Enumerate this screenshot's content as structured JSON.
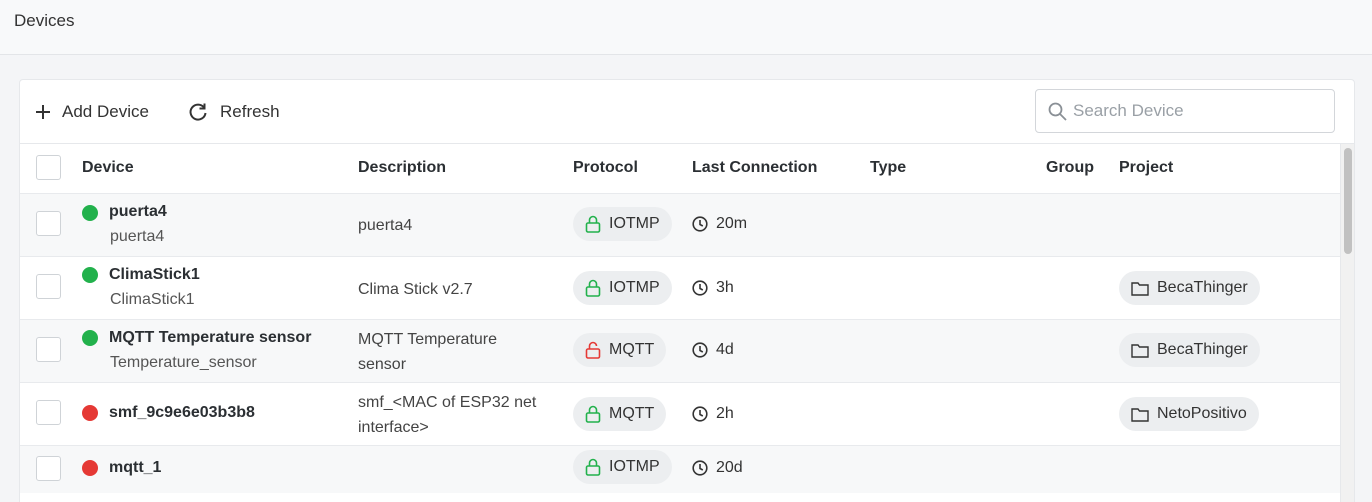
{
  "page": {
    "title": "Devices"
  },
  "toolbar": {
    "add_label": "Add Device",
    "refresh_label": "Refresh",
    "search_placeholder": "Search Device"
  },
  "columns": {
    "device": "Device",
    "description": "Description",
    "protocol": "Protocol",
    "last_connection": "Last Connection",
    "type": "Type",
    "group": "Group",
    "project": "Project"
  },
  "colors": {
    "online": "#22b14c",
    "offline": "#e53935",
    "lock_secure": "#22b14c",
    "lock_insecure": "#e53935"
  },
  "rows": [
    {
      "name": "puerta4",
      "id": "puerta4",
      "status": "online",
      "description": "puerta4",
      "protocol": "IOTMP",
      "secure": true,
      "last_connection": "20m",
      "project": ""
    },
    {
      "name": "ClimaStick1",
      "id": "ClimaStick1",
      "status": "online",
      "description": "Clima Stick v2.7",
      "protocol": "IOTMP",
      "secure": true,
      "last_connection": "3h",
      "project": "BecaThinger"
    },
    {
      "name": "MQTT Temperature sensor",
      "id": "Temperature_sensor",
      "status": "online",
      "description": "MQTT Temperature sensor",
      "protocol": "MQTT",
      "secure": false,
      "last_connection": "4d",
      "project": "BecaThinger"
    },
    {
      "name": "smf_9c9e6e03b3b8",
      "id": "",
      "status": "offline",
      "description": "smf_<MAC of ESP32 net interface>",
      "protocol": "MQTT",
      "secure": true,
      "last_connection": "2h",
      "project": "NetoPositivo"
    },
    {
      "name": "mqtt_1",
      "id": "",
      "status": "offline",
      "description": "",
      "protocol": "IOTMP",
      "secure": true,
      "last_connection": "20d",
      "project": ""
    }
  ]
}
